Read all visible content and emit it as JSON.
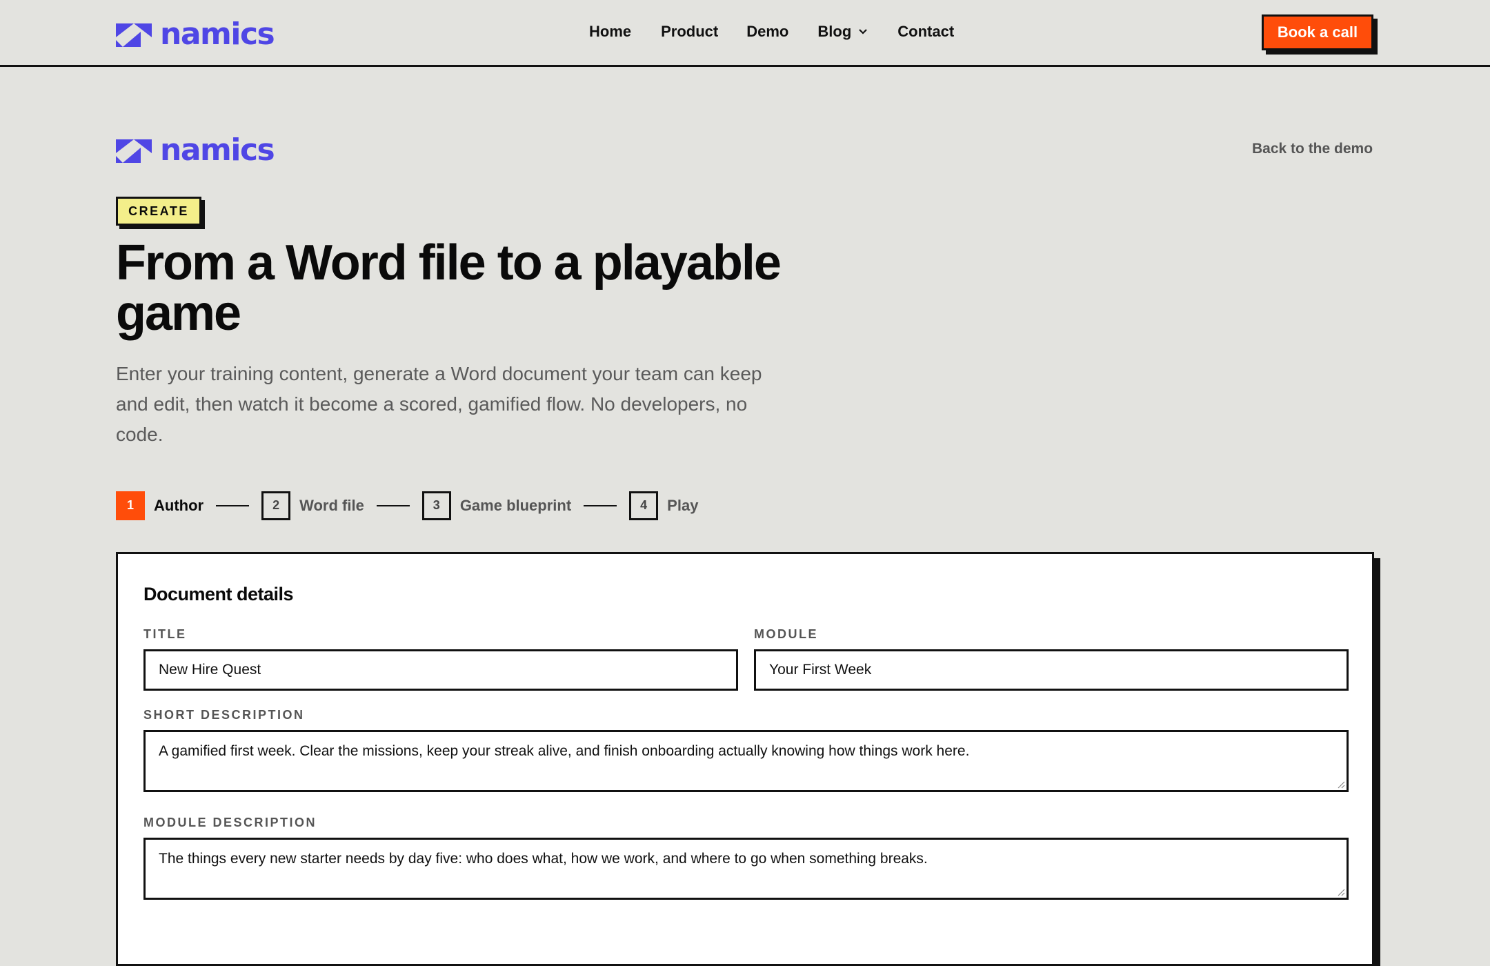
{
  "brand": {
    "name": "namics",
    "color": "#4f46e5"
  },
  "nav": {
    "links": [
      "Home",
      "Product",
      "Demo",
      "Blog",
      "Contact"
    ],
    "cta": "Book a call"
  },
  "header": {
    "back_link": "Back to the demo",
    "badge": "CREATE",
    "headline": "From a Word file to a playable game",
    "lede": "Enter your training content, generate a Word document your team can keep and edit, then watch it become a scored, gamified flow. No developers, no code."
  },
  "steps": [
    {
      "num": "1",
      "label": "Author",
      "active": true
    },
    {
      "num": "2",
      "label": "Word file",
      "active": false
    },
    {
      "num": "3",
      "label": "Game blueprint",
      "active": false
    },
    {
      "num": "4",
      "label": "Play",
      "active": false
    }
  ],
  "form": {
    "section_title": "Document details",
    "title_label": "TITLE",
    "title_value": "New Hire Quest",
    "module_label": "MODULE",
    "module_value": "Your First Week",
    "short_desc_label": "SHORT DESCRIPTION",
    "short_desc_value": "A gamified first week. Clear the missions, keep your streak alive, and finish onboarding actually knowing how things work here.",
    "module_desc_label": "MODULE DESCRIPTION",
    "module_desc_value": "The things every new starter needs by day five: who does what, how we work, and where to go when something breaks."
  },
  "colors": {
    "accent": "#ff4d0a",
    "badge": "#f3ee8a",
    "background": "#e3e3df"
  }
}
